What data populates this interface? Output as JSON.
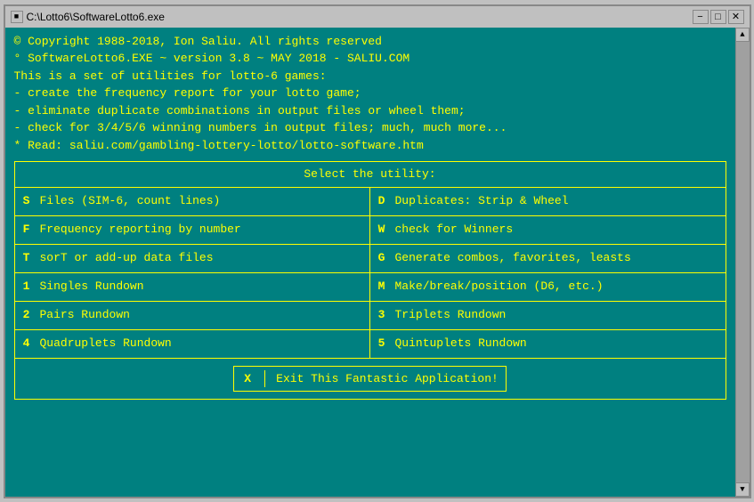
{
  "window": {
    "title": "C:\\Lotto6\\SoftwareLotto6.exe",
    "title_icon": "■"
  },
  "title_buttons": {
    "minimize": "−",
    "maximize": "□",
    "close": "✕"
  },
  "intro": {
    "line1": "© Copyright 1988-2018, Ion Saliu. All rights reserved",
    "line2": "° SoftwareLotto6.EXE ~ version 3.8 ~ MAY 2018 - SALIU.COM",
    "line3": "  This is a set of utilities for lotto-6 games:",
    "line4": "  - create the frequency report for your lotto game;",
    "line5": "  - eliminate duplicate combinations in output files or wheel them;",
    "line6": "  - check for 3/4/5/6 winning numbers in output files; much, much more...",
    "line7": "* Read: saliu.com/gambling-lottery-lotto/lotto-software.htm"
  },
  "utility_box": {
    "title": "Select the utility:"
  },
  "grid": [
    {
      "left_key": "S",
      "left_value": "Files (SIM-6, count lines)",
      "right_key": "D",
      "right_value": "Duplicates: Strip & Wheel"
    },
    {
      "left_key": "F",
      "left_value": "Frequency reporting by number",
      "right_key": "W",
      "right_value": "check for Winners"
    },
    {
      "left_key": "T",
      "left_value": "sorT or add-up data files",
      "right_key": "G",
      "right_value": "Generate combos, favorites, leasts"
    },
    {
      "left_key": "1",
      "left_value": "Singles Rundown",
      "right_key": "M",
      "right_value": "Make/break/position (D6, etc.)"
    },
    {
      "left_key": "2",
      "left_value": "Pairs Rundown",
      "right_key": "3",
      "right_value": "Triplets Rundown"
    },
    {
      "left_key": "4",
      "left_value": "Quadruplets Rundown",
      "right_key": "5",
      "right_value": "Quintuplets Rundown"
    }
  ],
  "exit": {
    "key": "X",
    "label": "Exit This Fantastic Application!"
  }
}
